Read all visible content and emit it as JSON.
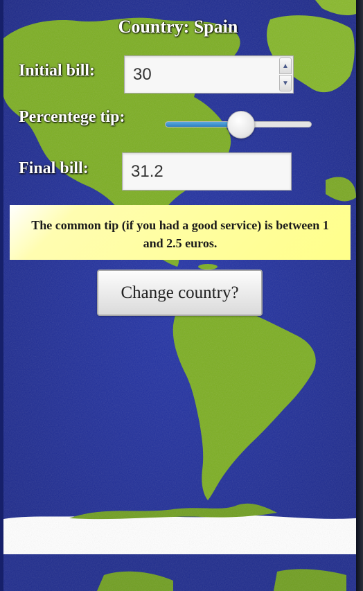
{
  "title": "Country: Spain",
  "form": {
    "initial_bill_label": "Initial bill:",
    "initial_bill_value": "30",
    "tip_label": "Percentege tip:",
    "tip_slider_fraction": 0.52,
    "final_bill_label": "Final bill:",
    "final_bill_value": "31.2"
  },
  "info": {
    "text": "The common tip (if you had a good service) is between 1 and 2.5 euros."
  },
  "button": {
    "label": "Change country?"
  },
  "colors": {
    "ocean": "#1f2f96",
    "land": "#7cb022",
    "info_bg": "#ffff8a",
    "slider_fill": "#3d8fd0"
  },
  "icons": {
    "spinner_up": "triangle-up-icon",
    "spinner_down": "triangle-down-icon"
  }
}
